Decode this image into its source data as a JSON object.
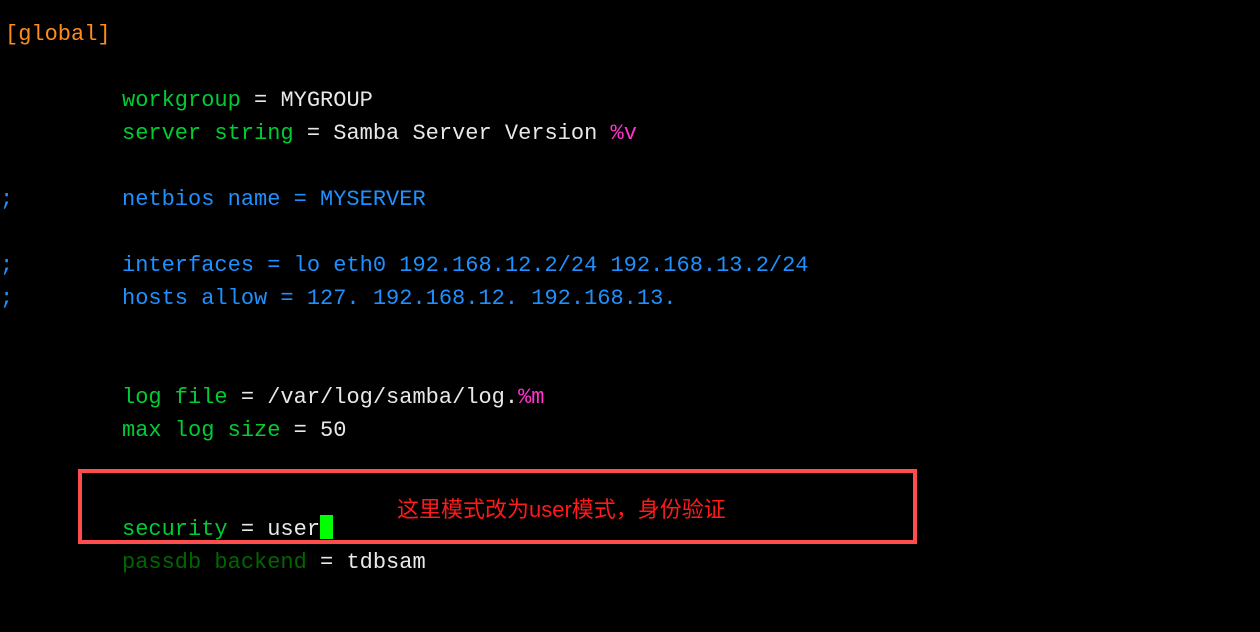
{
  "section_header": "[global]",
  "workgroup_key": "workgroup",
  "workgroup_val": "MYGROUP",
  "server_string_key": "server string",
  "server_string_val": "Samba Server Version ",
  "server_string_var": "%v",
  "netbios_key": "netbios name = MYSERVER",
  "interfaces_key": "interfaces = lo eth0 192.168.12.2/24 192.168.13.2/24",
  "hosts_allow_key": "hosts allow = 127. 192.168.12. 192.168.13.",
  "log_file_key": "log file",
  "log_file_val": "/var/log/samba/log.",
  "log_file_var": "%m",
  "max_log_key": "max log size",
  "max_log_val": "50",
  "security_key": "security",
  "security_val": "user",
  "passdb_key": "passdb backend",
  "passdb_val": "tdbsam",
  "eq": " = ",
  "annotation_text": "这里模式改为user模式，身份验证"
}
